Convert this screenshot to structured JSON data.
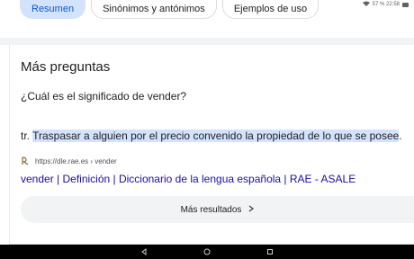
{
  "status_bar": {
    "text": "57 %   22:58"
  },
  "chips": [
    {
      "label": "Resumen",
      "active": true
    },
    {
      "label": "Sinónimos y antónimos",
      "active": false
    },
    {
      "label": "Ejemplos de uso",
      "active": false
    }
  ],
  "section": {
    "title": "Más preguntas",
    "question": "¿Cuál es el significado de vender?",
    "definition_prefix": "tr. ",
    "definition_highlight": "Traspasar a alguien por el precio convenido la propiedad de lo que se posee",
    "definition_suffix": ".",
    "source_url": "https://dle.rae.es › vender",
    "result_title": "vender | Definición | Diccionario de la lengua española | RAE - ASALE",
    "more_results_label": "Más resultados"
  },
  "colors": {
    "accent": "#1a0dab",
    "chip_active": "#d3e3fd",
    "highlight": "#d3e3fd"
  }
}
